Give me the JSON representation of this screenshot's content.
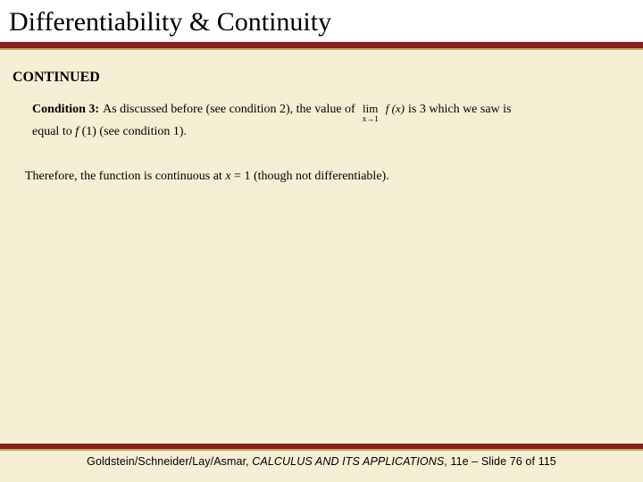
{
  "title": "Differentiability & Continuity",
  "continued_label": "CONTINUED",
  "condition": {
    "label": "Condition 3:",
    "text_before": "As discussed before (see condition 2), the value of",
    "lim_top": "lim",
    "lim_sub": "x→1",
    "fx": "f (x)",
    "text_after": "is 3 which we saw is",
    "line2_a": "equal to ",
    "line2_fx": "f ",
    "line2_b": "(1) (see condition 1)."
  },
  "conclusion": {
    "text_a": "Therefore, the function is continuous at ",
    "xeq": "x",
    "text_b": " = 1 (though not differentiable)."
  },
  "footer": {
    "authors": "Goldstein/Schneider/Lay/Asmar, ",
    "book": "CALCULUS AND ITS APPLICATIONS",
    "edition": ", 11e – Slide 76 of 115"
  }
}
